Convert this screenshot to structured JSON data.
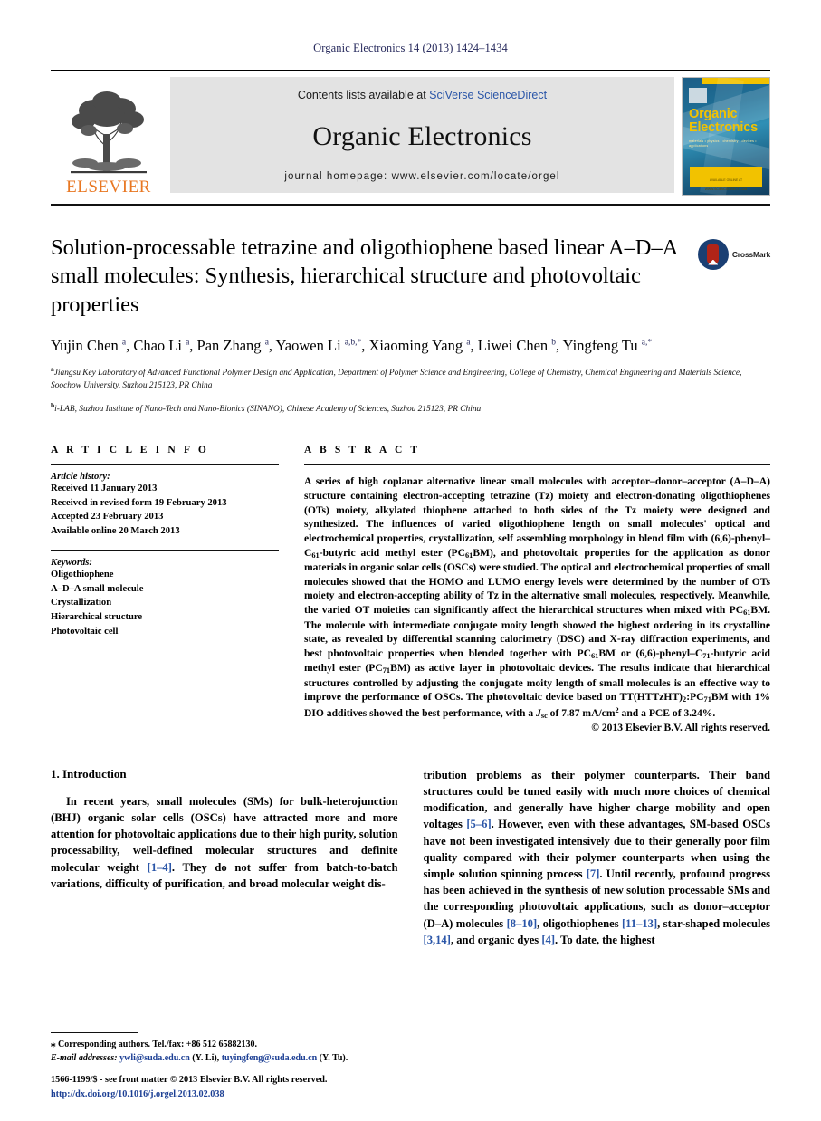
{
  "running_head": "Organic Electronics 14 (2013) 1424–1434",
  "masthead": {
    "contents_prefix": "Contents lists available at ",
    "sciencedirect": "SciVerse ScienceDirect",
    "journal_title": "Organic Electronics",
    "homepage": "journal homepage: www.elsevier.com/locate/orgel",
    "publisher": "ELSEVIER",
    "cover": {
      "title_line1": "Organic",
      "title_line2": "Electronics",
      "subtitle": "materials • physics • chemistry • devices • applications",
      "footer_text": "AVAILABLE ONLINE AT WWW.SCIENCEDIRECT.COM"
    }
  },
  "article": {
    "title": "Solution-processable tetrazine and oligothiophene based linear A–D–A small molecules: Synthesis, hierarchical structure and photovoltaic properties",
    "crossmark_label": "CrossMark",
    "authors": [
      {
        "name": "Yujin Chen",
        "marks": "a"
      },
      {
        "name": "Chao Li",
        "marks": "a"
      },
      {
        "name": "Pan Zhang",
        "marks": "a"
      },
      {
        "name": "Yaowen Li",
        "marks": "a,b,*"
      },
      {
        "name": "Xiaoming Yang",
        "marks": "a"
      },
      {
        "name": "Liwei Chen",
        "marks": "b"
      },
      {
        "name": "Yingfeng Tu",
        "marks": "a,*"
      }
    ],
    "affiliations": [
      {
        "mark": "a",
        "text": "Jiangsu Key Laboratory of Advanced Functional Polymer Design and Application, Department of Polymer Science and Engineering, College of Chemistry, Chemical Engineering and Materials Science, Soochow University, Suzhou 215123, PR China"
      },
      {
        "mark": "b",
        "text": "i-LAB, Suzhou Institute of Nano-Tech and Nano-Bionics (SINANO), Chinese Academy of Sciences, Suzhou 215123, PR China"
      }
    ]
  },
  "article_info": {
    "heading": "A R T I C L E   I N F O",
    "history_label": "Article history:",
    "history": [
      "Received 11 January 2013",
      "Received in revised form 19 February 2013",
      "Accepted 23 February 2013",
      "Available online 20 March 2013"
    ],
    "keywords_label": "Keywords:",
    "keywords": [
      "Oligothiophene",
      "A–D–A small molecule",
      "Crystallization",
      "Hierarchical structure",
      "Photovoltaic cell"
    ]
  },
  "abstract": {
    "heading": "A B S T R A C T",
    "copyright": "© 2013 Elsevier B.V. All rights reserved."
  },
  "introduction": {
    "heading": "1. Introduction"
  },
  "footnote": {
    "corresponding": "Corresponding authors. Tel./fax: +86 512 65882130.",
    "email_label": "E-mail addresses:",
    "email1": "ywli@suda.edu.cn",
    "email1_owner": "(Y. Li),",
    "email2": "tuyingfeng@suda.edu.cn",
    "email2_owner": "(Y. Tu)."
  },
  "imprint": {
    "line1": "1566-1199/$ - see front matter © 2013 Elsevier B.V. All rights reserved.",
    "doi": "http://dx.doi.org/10.1016/j.orgel.2013.02.038"
  }
}
